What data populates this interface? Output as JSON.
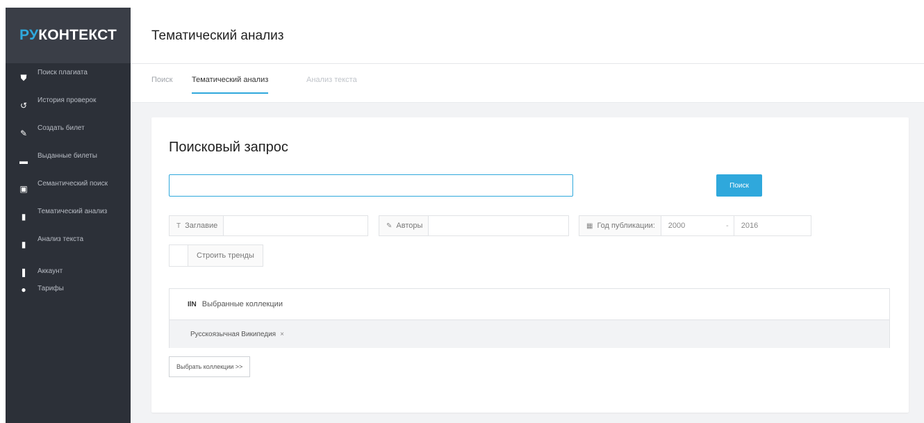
{
  "brand": {
    "part1": "РУ",
    "part2": "КОНТЕКСТ",
    "accent": "#2fa8dc",
    "sidebar_bg": "#2c3038"
  },
  "sidebar": {
    "items": [
      {
        "icon": "shield-icon",
        "glyph": "⛊",
        "label": "Поиск плагиата"
      },
      {
        "icon": "history-icon",
        "glyph": "↺",
        "label": "История проверок"
      },
      {
        "icon": "pencil-icon",
        "glyph": "✎",
        "label": "Создать билет"
      },
      {
        "icon": "folder-icon",
        "glyph": "▬",
        "label": "Выданные билеты"
      },
      {
        "icon": "search-doc-icon",
        "glyph": "▣",
        "label": "Семантический поиск"
      },
      {
        "icon": "doc-icon",
        "glyph": "▮",
        "label": "Тематический анализ"
      },
      {
        "icon": "file-icon",
        "glyph": "▮",
        "label": "Анализ текста"
      },
      {
        "icon": "user-icon",
        "glyph": "❚",
        "label": "Аккаунт"
      },
      {
        "icon": "info-icon",
        "glyph": "●",
        "label": "Тарифы"
      }
    ]
  },
  "header": {
    "title": "Тематический анализ"
  },
  "tabs": [
    {
      "label": "Поиск"
    },
    {
      "label": "Тематический анализ",
      "active": true
    },
    {
      "label": "Анализ текста"
    }
  ],
  "form": {
    "title": "Поисковый запрос",
    "search_value": "",
    "search_button": "Поиск",
    "title_filter": {
      "icon": "text-icon",
      "label": "Заглавие",
      "value": ""
    },
    "authors_filter": {
      "icon": "pencil-icon",
      "label": "Авторы",
      "value": ""
    },
    "year_filter": {
      "icon": "calendar-icon",
      "label": "Год публикации:",
      "from": "2000",
      "separator": "-",
      "to": "2016"
    },
    "trends_label": "Строить тренды",
    "collections": {
      "header": "Выбранные коллекции",
      "items": [
        {
          "label": "Русскоязычная Википедия",
          "remove": "×"
        }
      ]
    },
    "choose_button": "Выбрать коллекции >>"
  }
}
